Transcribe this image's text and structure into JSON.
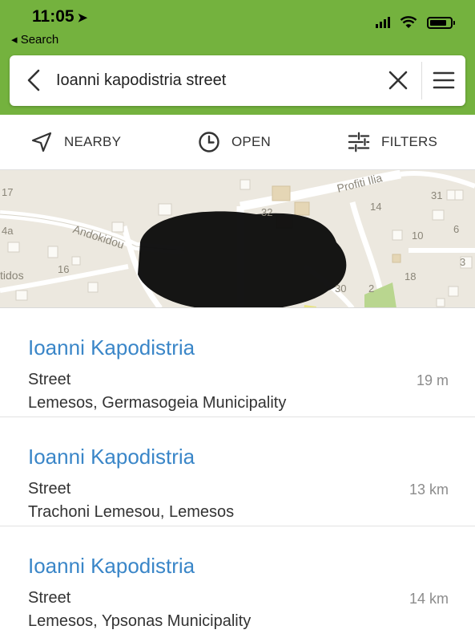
{
  "status_bar": {
    "time": "11:05",
    "back_app": "◂ Search"
  },
  "search": {
    "query": "Ioanni kapodistria street"
  },
  "filters": [
    {
      "label": "NEARBY",
      "icon": "navigation-arrow-icon"
    },
    {
      "label": "OPEN",
      "icon": "clock-icon"
    },
    {
      "label": "FILTERS",
      "icon": "sliders-icon"
    }
  ],
  "map": {
    "labels": {
      "profiti_ilia": "Profiti Ilia",
      "andokidou": "Andokidou",
      "tidos": "tidos",
      "n17": "17",
      "n4a": "4a",
      "n16": "16",
      "n32": "32",
      "n14": "14",
      "n31": "31",
      "n10": "10",
      "n6": "6",
      "n3": "3",
      "n18": "18",
      "n30": "30",
      "n2": "2"
    }
  },
  "results": [
    {
      "title": "Ioanni Kapodistria",
      "type": "Street",
      "distance": "19 m",
      "location": "Lemesos, Germasogeia Municipality"
    },
    {
      "title": "Ioanni Kapodistria",
      "type": "Street",
      "distance": "13 km",
      "location": "Trachoni Lemesou, Lemesos"
    },
    {
      "title": "Ioanni Kapodistria",
      "type": "Street",
      "distance": "14 km",
      "location": "Lemesos, Ypsonas Municipality"
    }
  ],
  "colors": {
    "header_green": "#74b23e",
    "link_blue": "#3a86c8"
  }
}
